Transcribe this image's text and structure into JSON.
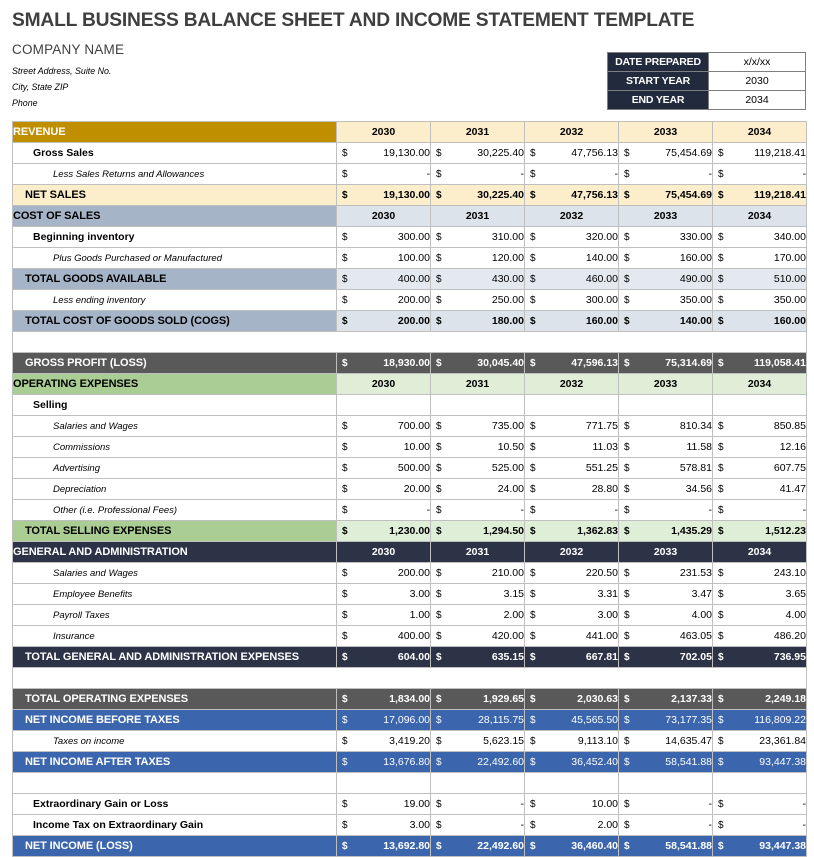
{
  "title": "SMALL BUSINESS BALANCE SHEET AND INCOME STATEMENT TEMPLATE",
  "company": {
    "name": "COMPANY NAME",
    "street": "Street Address, Suite No.",
    "city": "City, State ZIP",
    "phone": "Phone"
  },
  "meta": {
    "rows": [
      {
        "label": "DATE PREPARED",
        "value": "x/x/xx"
      },
      {
        "label": "START YEAR",
        "value": "2030"
      },
      {
        "label": "END YEAR",
        "value": "2034"
      }
    ]
  },
  "years": [
    "2030",
    "2031",
    "2032",
    "2033",
    "2034"
  ],
  "colors": {
    "revenue_header": "#BF8F00",
    "revenue_band": "#FDEECB",
    "cost_of_sales_header": "#A6B4C8",
    "cost_of_sales_band": "#DDE3EA",
    "gross_profit": "#595959",
    "operating_expenses_header": "#A9CD92",
    "operating_expenses_band": "#E0EED8",
    "gna_header": "#2C3347",
    "net_income": "#3B66AE",
    "grid": "#BFBFBF"
  },
  "currency_symbol": "$",
  "rows": [
    {
      "id": "revenue-header",
      "style": "r-revenue",
      "label": "REVENUE",
      "label_class": "lbl sec",
      "cells_are_years": true
    },
    {
      "id": "gross-sales",
      "style": "r-plain",
      "label": "Gross Sales",
      "label_class": "lbl indent1",
      "values": [
        "19,130.00",
        "30,225.40",
        "47,756.13",
        "75,454.69",
        "119,218.41"
      ]
    },
    {
      "id": "less-sales-returns",
      "style": "r-plain",
      "label": "Less Sales Returns and Allowances",
      "label_class": "lbl indent2",
      "values": [
        "-",
        "-",
        "-",
        "-",
        "-"
      ]
    },
    {
      "id": "net-sales",
      "style": "r-netsales",
      "label": "NET SALES",
      "label_class": "lbl tot",
      "bold": true,
      "values": [
        "19,130.00",
        "30,225.40",
        "47,756.13",
        "75,454.69",
        "119,218.41"
      ]
    },
    {
      "id": "cost-of-sales-header",
      "style": "r-cos",
      "label": "COST OF SALES",
      "label_class": "lbl sec",
      "cells_are_years": true
    },
    {
      "id": "beginning-inventory",
      "style": "r-plain",
      "label": "Beginning inventory",
      "label_class": "lbl indent1",
      "values": [
        "300.00",
        "310.00",
        "320.00",
        "330.00",
        "340.00"
      ]
    },
    {
      "id": "plus-goods-purchased",
      "style": "r-plain",
      "label": "Plus Goods Purchased or Manufactured",
      "label_class": "lbl indent2",
      "values": [
        "100.00",
        "120.00",
        "140.00",
        "160.00",
        "170.00"
      ]
    },
    {
      "id": "total-goods-available",
      "style": "r-subtot",
      "label": "TOTAL GOODS AVAILABLE",
      "label_class": "lbl tot",
      "values": [
        "400.00",
        "430.00",
        "460.00",
        "490.00",
        "510.00"
      ]
    },
    {
      "id": "less-ending-inventory",
      "style": "r-plain",
      "label": "Less ending inventory",
      "label_class": "lbl indent2",
      "values": [
        "200.00",
        "250.00",
        "300.00",
        "350.00",
        "350.00"
      ]
    },
    {
      "id": "total-cogs",
      "style": "r-cogs",
      "label": "TOTAL COST OF GOODS SOLD (COGS)",
      "label_class": "lbl tot",
      "bold": true,
      "values": [
        "200.00",
        "180.00",
        "160.00",
        "140.00",
        "160.00"
      ]
    },
    {
      "id": "spacer-1",
      "style": "spacer",
      "spacer": true
    },
    {
      "id": "gross-profit",
      "style": "r-gross",
      "label": "GROSS PROFIT (LOSS)",
      "label_class": "lbl tot",
      "bold": true,
      "values": [
        "18,930.00",
        "30,045.40",
        "47,596.13",
        "75,314.69",
        "119,058.41"
      ]
    },
    {
      "id": "operating-expenses-header",
      "style": "r-opex",
      "label": "OPERATING EXPENSES",
      "label_class": "lbl sec",
      "cells_are_years": true
    },
    {
      "id": "selling",
      "style": "r-plain",
      "label": "Selling",
      "label_class": "lbl indent1",
      "values": [
        "",
        "",
        "",
        "",
        ""
      ],
      "no_symbol": true
    },
    {
      "id": "selling-salaries-and-wages",
      "style": "r-plain",
      "label": "Salaries and Wages",
      "label_class": "lbl indent2",
      "values": [
        "700.00",
        "735.00",
        "771.75",
        "810.34",
        "850.85"
      ]
    },
    {
      "id": "selling-commissions",
      "style": "r-plain",
      "label": "Commissions",
      "label_class": "lbl indent2",
      "values": [
        "10.00",
        "10.50",
        "11.03",
        "11.58",
        "12.16"
      ]
    },
    {
      "id": "selling-advertising",
      "style": "r-plain",
      "label": "Advertising",
      "label_class": "lbl indent2",
      "values": [
        "500.00",
        "525.00",
        "551.25",
        "578.81",
        "607.75"
      ]
    },
    {
      "id": "selling-depreciation",
      "style": "r-plain",
      "label": "Depreciation",
      "label_class": "lbl indent2",
      "values": [
        "20.00",
        "24.00",
        "28.80",
        "34.56",
        "41.47"
      ]
    },
    {
      "id": "selling-other",
      "style": "r-plain",
      "label": "Other (i.e. Professional Fees)",
      "label_class": "lbl indent2",
      "values": [
        "-",
        "-",
        "-",
        "-",
        "-"
      ]
    },
    {
      "id": "total-selling-expenses",
      "style": "r-sellingtot",
      "label": "TOTAL SELLING EXPENSES",
      "label_class": "lbl tot",
      "bold": true,
      "values": [
        "1,230.00",
        "1,294.50",
        "1,362.83",
        "1,435.29",
        "1,512.23"
      ]
    },
    {
      "id": "gna-header",
      "style": "r-gna",
      "label": "GENERAL AND ADMINISTRATION",
      "label_class": "lbl sec",
      "cells_are_years": true
    },
    {
      "id": "gna-salaries-and-wages",
      "style": "r-plain",
      "label": "Salaries and Wages",
      "label_class": "lbl indent2",
      "values": [
        "200.00",
        "210.00",
        "220.50",
        "231.53",
        "243.10"
      ]
    },
    {
      "id": "gna-employee-benefits",
      "style": "r-plain",
      "label": "Employee Benefits",
      "label_class": "lbl indent2",
      "values": [
        "3.00",
        "3.15",
        "3.31",
        "3.47",
        "3.65"
      ]
    },
    {
      "id": "gna-payroll-taxes",
      "style": "r-plain",
      "label": "Payroll Taxes",
      "label_class": "lbl indent2",
      "values": [
        "1.00",
        "2.00",
        "3.00",
        "4.00",
        "4.00"
      ]
    },
    {
      "id": "gna-insurance",
      "style": "r-plain",
      "label": "Insurance",
      "label_class": "lbl indent2",
      "values": [
        "400.00",
        "420.00",
        "441.00",
        "463.05",
        "486.20"
      ]
    },
    {
      "id": "total-gna-expenses",
      "style": "r-gnatot",
      "label": "TOTAL GENERAL AND ADMINISTRATION EXPENSES",
      "label_class": "lbl tot",
      "bold": true,
      "values": [
        "604.00",
        "635.15",
        "667.81",
        "702.05",
        "736.95"
      ]
    },
    {
      "id": "spacer-2",
      "style": "spacer",
      "spacer": true
    },
    {
      "id": "total-operating-expenses",
      "style": "r-totopex",
      "label": "TOTAL OPERATING EXPENSES",
      "label_class": "lbl tot",
      "bold": true,
      "values": [
        "1,834.00",
        "1,929.65",
        "2,030.63",
        "2,137.33",
        "2,249.18"
      ]
    },
    {
      "id": "net-income-before-taxes",
      "style": "r-blue",
      "label": "NET INCOME BEFORE TAXES",
      "label_class": "lbl tot",
      "values": [
        "17,096.00",
        "28,115.75",
        "45,565.50",
        "73,177.35",
        "116,809.22"
      ]
    },
    {
      "id": "taxes-on-income",
      "style": "r-plain",
      "label": "Taxes on income",
      "label_class": "lbl indent2",
      "values": [
        "3,419.20",
        "5,623.15",
        "9,113.10",
        "14,635.47",
        "23,361.84"
      ]
    },
    {
      "id": "net-income-after-taxes",
      "style": "r-blue",
      "label": "NET INCOME AFTER TAXES",
      "label_class": "lbl tot",
      "values": [
        "13,676.80",
        "22,492.60",
        "36,452.40",
        "58,541.88",
        "93,447.38"
      ]
    },
    {
      "id": "blank-row-1",
      "style": "r-empty",
      "label": "",
      "label_class": "lbl",
      "values": [
        "",
        "",
        "",
        "",
        ""
      ],
      "no_symbol": true
    },
    {
      "id": "extraordinary-gain-or-loss",
      "style": "r-plain",
      "label": "Extraordinary Gain or Loss",
      "label_class": "lbl indent1",
      "values": [
        "19.00",
        "-",
        "10.00",
        "-",
        "-"
      ]
    },
    {
      "id": "income-tax-on-extraordinary-gain",
      "style": "r-plain",
      "label": "Income Tax on Extraordinary Gain",
      "label_class": "lbl indent1",
      "values": [
        "3.00",
        "-",
        "2.00",
        "-",
        "-"
      ]
    },
    {
      "id": "net-income-loss",
      "style": "r-blue",
      "label": "NET INCOME (LOSS)",
      "label_class": "lbl tot",
      "bold": true,
      "values": [
        "13,692.80",
        "22,492.60",
        "36,460.40",
        "58,541.88",
        "93,447.38"
      ]
    }
  ]
}
